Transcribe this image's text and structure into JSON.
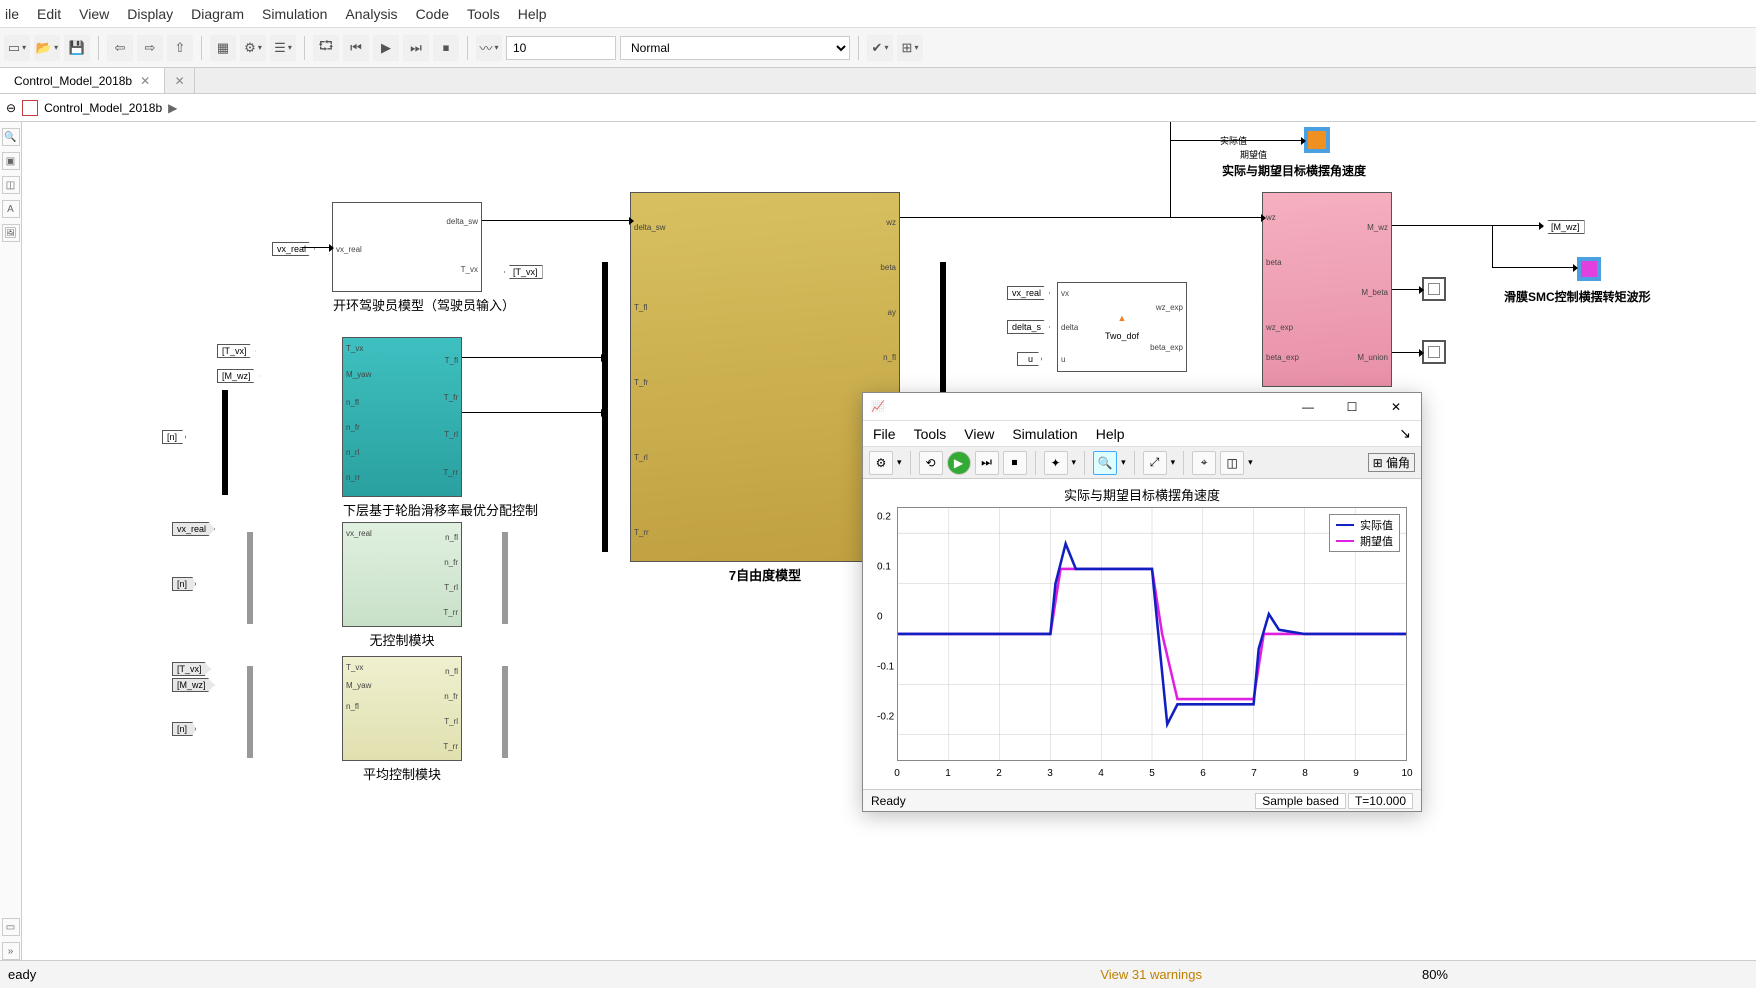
{
  "menu": {
    "items": [
      "ile",
      "Edit",
      "View",
      "Display",
      "Diagram",
      "Simulation",
      "Analysis",
      "Code",
      "Tools",
      "Help"
    ]
  },
  "toolbar": {
    "stoptime": "10",
    "mode": "Normal"
  },
  "tabs": {
    "name": "Control_Model_2018b"
  },
  "breadcrumb": {
    "root": "Control_Model_2018b"
  },
  "blocks": {
    "driver": {
      "label": "开环驾驶员模型（驾驶员输入）",
      "p_in": "vx_real",
      "p_out1": "delta_sw",
      "p_out2": "T_vx"
    },
    "tire": {
      "label": "下层基于轮胎滑移率最优分配控制",
      "in1": "T_vx",
      "in2": "M_yaw",
      "in3": "n_fl",
      "in4": "n_fr",
      "in5": "n_rl",
      "in6": "n_rr",
      "o1": "T_fl",
      "o2": "T_fr",
      "o3": "T_rl",
      "o4": "T_rr"
    },
    "noctl": {
      "label": "无控制模块",
      "in1": "vx_real",
      "o1": "n_fl",
      "o2": "n_fr",
      "o3": "T_rl",
      "o4": "T_rr"
    },
    "avgctl": {
      "label": "平均控制模块",
      "in1": "T_vx",
      "in2": "M_yaw",
      "o1": "n_fl",
      "o2": "n_fr",
      "o3": "T_rl",
      "o4": "T_rr",
      "in3": "n_fl"
    },
    "dof7": {
      "label": "7自由度模型",
      "i1": "delta_sw",
      "i2": "T_fl",
      "i3": "T_fr",
      "i4": "T_rl",
      "i5": "T_rr",
      "o1": "wz",
      "o2": "beta",
      "o3": "ay",
      "o4": "n_fl"
    },
    "twodof": {
      "label": "Two_dof",
      "i1": "vx",
      "i2": "delta",
      "i3": "u",
      "o1": "wz_exp",
      "o2": "beta_exp"
    },
    "smc": {
      "i1": "wz",
      "i2": "beta",
      "i3": "wz_exp",
      "i4": "beta_exp",
      "o1": "M_wz",
      "o2": "M_beta",
      "o3": "M_union"
    },
    "scopeLabel1": "实际与期望目标横摆角速度",
    "scopeLabel2": "滑膜SMC控制横摆转矩波形",
    "sig_act": "实际值",
    "sig_exp": "期望值"
  },
  "tags": {
    "vx_real": "vx_real",
    "T_vx": "[T_vx]",
    "M_wz": "[M_wz]",
    "n": "[n]",
    "vx_real2": "vx_real",
    "delta_s": "delta_s",
    "u": "u",
    "Mwz2": "[M_wz]",
    "T_vx2": "[T_vx]"
  },
  "scope": {
    "menu": [
      "File",
      "Tools",
      "View",
      "Simulation",
      "Help"
    ],
    "title": "实际与期望目标横摆角速度",
    "side": "偏角",
    "legend": {
      "actual": "实际值",
      "expected": "期望值"
    },
    "status": {
      "ready": "Ready",
      "mode": "Sample based",
      "time": "T=10.000"
    }
  },
  "chart_data": {
    "type": "line",
    "title": "实际与期望目标横摆角速度",
    "xlabel": "",
    "ylabel": "",
    "xlim": [
      0,
      10
    ],
    "ylim": [
      -0.25,
      0.25
    ],
    "xticks": [
      0,
      1,
      2,
      3,
      4,
      5,
      6,
      7,
      8,
      9,
      10
    ],
    "yticks": [
      -0.2,
      -0.1,
      0,
      0.1,
      0.2
    ],
    "series": [
      {
        "name": "实际值",
        "color": "#1020c0",
        "x": [
          0,
          3,
          3.1,
          3.3,
          3.5,
          4,
          4.5,
          5,
          5.1,
          5.3,
          5.5,
          6,
          6.5,
          7,
          7.1,
          7.3,
          7.5,
          8,
          10
        ],
        "y": [
          0,
          0,
          0.1,
          0.18,
          0.13,
          0.13,
          0.13,
          0.13,
          0.02,
          -0.18,
          -0.14,
          -0.14,
          -0.14,
          -0.14,
          -0.03,
          0.04,
          0.01,
          0,
          0
        ]
      },
      {
        "name": "期望值",
        "color": "#e020e0",
        "x": [
          0,
          3,
          3.2,
          3.5,
          4,
          4.5,
          5,
          5.2,
          5.5,
          6,
          6.5,
          7,
          7.2,
          7.5,
          8,
          10
        ],
        "y": [
          0,
          0,
          0.12,
          0.13,
          0.13,
          0.13,
          0.13,
          0,
          -0.13,
          -0.13,
          -0.13,
          -0.13,
          0,
          0,
          0,
          0
        ]
      }
    ]
  },
  "status": {
    "ready": "eady",
    "warn": "View 31 warnings",
    "zoom": "80%"
  }
}
